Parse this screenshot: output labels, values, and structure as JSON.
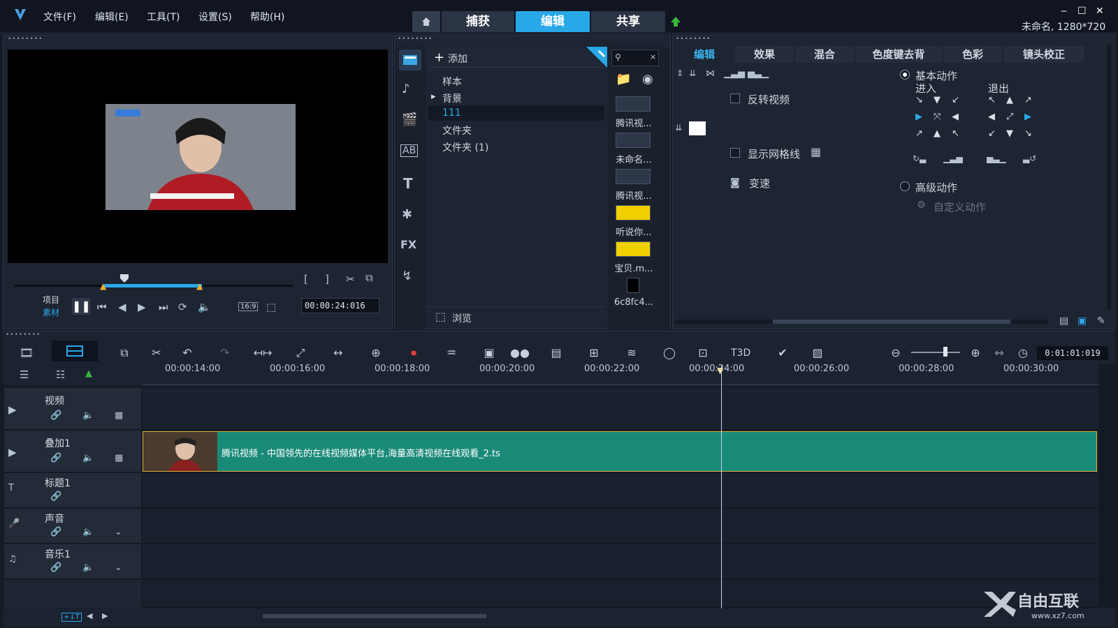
{
  "titlebar": {
    "menu": [
      "文件(F)",
      "编辑(E)",
      "工具(T)",
      "设置(S)",
      "帮助(H)"
    ],
    "tabs": {
      "capture": "捕获",
      "edit": "编辑",
      "share": "共享"
    },
    "project_info": "未命名, 1280*720",
    "window_controls": {
      "minimize": "‒",
      "maximize": "☐",
      "close": "✕"
    }
  },
  "player": {
    "mode_project": "项目",
    "mode_clip": "素材",
    "aspect": "16:9",
    "timecode": "00:00:24:016"
  },
  "library": {
    "add_label": "添加",
    "folders": [
      "样本",
      "背景",
      "111",
      "文件夹",
      "文件夹 (1)"
    ],
    "browse_label": "浏览",
    "media": [
      {
        "name": "腾讯视..."
      },
      {
        "name": "未命名..."
      },
      {
        "name": "腾讯视..."
      },
      {
        "name": "听说你..."
      },
      {
        "name": "宝贝.m..."
      },
      {
        "name": "6c8fc4..."
      }
    ],
    "side_icons": [
      "media-icon",
      "audio-icon",
      "instant-project-icon",
      "transition-icon",
      "title-icon",
      "graphics-icon",
      "fx-icon",
      "path-icon"
    ],
    "side_fx_text": "FX",
    "side_title_text": "T"
  },
  "options": {
    "tabs": [
      "编辑",
      "效果",
      "混合",
      "色度键去背",
      "色彩",
      "镜头校正"
    ],
    "reverse_video": "反转视频",
    "show_grid": "显示网格线",
    "speed": "变速",
    "basic_motion": "基本动作",
    "enter": "进入",
    "exit": "退出",
    "advanced_motion": "高级动作",
    "custom_motion": "自定义动作"
  },
  "timeline": {
    "ruler": [
      "00:00:14:00",
      "00:00:16:00",
      "00:00:18:00",
      "00:00:20:00",
      "00:00:22:00",
      "00:00:24:00",
      "00:00:26:00",
      "00:00:28:00",
      "00:00:30:00"
    ],
    "zoom_time": "0:01:01:019",
    "tracks": [
      {
        "name": "视频"
      },
      {
        "name": "叠加1"
      },
      {
        "name": "标题1"
      },
      {
        "name": "声音"
      },
      {
        "name": "音乐1"
      }
    ],
    "clip_label": "腾讯视频 - 中国领先的在线视频媒体平台,海量高清视频在线观看_2.ts",
    "bottom_btn": "+↓T"
  },
  "watermark": {
    "text": "自由互联",
    "url": "www.xz7.com"
  },
  "colors": {
    "accent": "#29a8e8",
    "clip": "#1a8a78",
    "bg": "#151b27"
  }
}
